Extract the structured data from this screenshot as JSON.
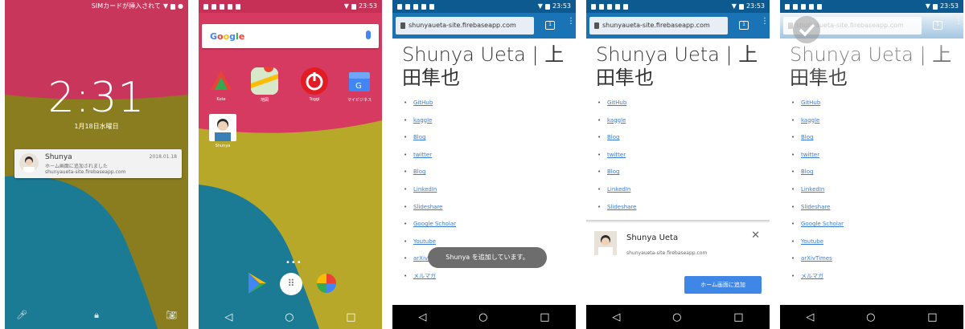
{
  "lockscreen": {
    "status_text": "SIMカードが挿入されて",
    "time": "2:31",
    "date": "1月18日水曜日",
    "notification": {
      "title": "Shunya",
      "time": "2018.01.18",
      "message": "ホーム画面に追加されました",
      "source": "shunyaueta-site.firebaseapp.com"
    },
    "bottom_icons": [
      "mic-icon",
      "lock-icon",
      "camera-icon"
    ]
  },
  "homescreen": {
    "status_time": "23:53",
    "search_logo": "Google",
    "apps": [
      {
        "label": "Kote",
        "icon": "kote-icon"
      },
      {
        "label": "地図",
        "icon": "maps-icon"
      },
      {
        "label": "Toggl",
        "icon": "toggl-icon"
      },
      {
        "label": "マイビジネス",
        "icon": "mybusiness-icon"
      }
    ],
    "shortcut_label": "Shunya",
    "dock_dots": "•••"
  },
  "browser": {
    "status_time": "23:53",
    "url": "shunyaueta-site.firebaseapp.com",
    "heading": "Shunya Ueta | 上田隼也",
    "links": [
      "GitHub",
      "kaggle",
      "Blog",
      "twitter",
      "Blog",
      "LinkedIn",
      "Slideshare",
      "Google Scholar",
      "Youtube",
      "arXivTimes",
      "メルマガ"
    ],
    "toast": "Shunya を追加しています。",
    "sheet": {
      "name": "Shunya Ueta",
      "url": "shunyaueta-site.firebaseapp.com",
      "add_button": "ホーム画面に追加"
    }
  },
  "colors": {
    "chrome_blue": "#1a73b5",
    "status_blue": "#0d5a91",
    "link": "#3a7cd5",
    "wall_pink": "#d63a60",
    "wall_olive": "#8a7d1f",
    "wall_teal": "#1c7b94"
  }
}
